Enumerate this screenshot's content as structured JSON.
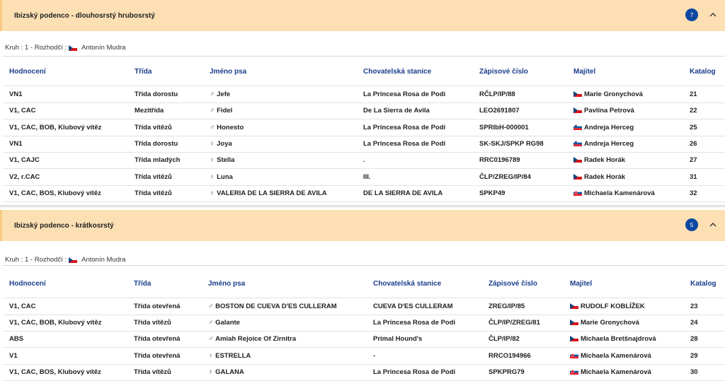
{
  "sections": [
    {
      "title": "Ibizský podenco - dlouhosrstý hrubosrstý",
      "count": "7",
      "kruh": "Kruh : 1 - Rozhodčí :",
      "judge": "Antonín Mudra",
      "headers": [
        "Hodnocení",
        "Třída",
        "Jméno psa",
        "Chovatelská stanice",
        "Zápisové číslo",
        "Majitel",
        "Katalog"
      ],
      "rows": [
        {
          "hodnoceni": "VN1",
          "trida": "Třída dorostu",
          "sex": "♂",
          "jmeno": "Jefe",
          "stanice": "La Princesa Rosa de Podi",
          "zapis": "RČLP/IP/88",
          "flag": "cz",
          "majitel": "Marie Gronychová",
          "katalog": "21"
        },
        {
          "hodnoceni": "V1, CAC",
          "trida": "Mezitřída",
          "sex": "♂",
          "jmeno": "Fidel",
          "stanice": "De La Sierra de Avila",
          "zapis": "LEO2691807",
          "flag": "cz",
          "majitel": "Pavlína Petrová",
          "katalog": "22"
        },
        {
          "hodnoceni": "V1, CAC, BOB, Klubový vítěz",
          "trida": "Třída vítězů",
          "sex": "♂",
          "jmeno": "Honesto",
          "stanice": "La Princesa Rosa de Podi",
          "zapis": "SPRIbH-000001",
          "flag": "si",
          "majitel": "Andreja Herceg",
          "katalog": "25"
        },
        {
          "hodnoceni": "VN1",
          "trida": "Třída dorostu",
          "sex": "♀",
          "jmeno": "Joya",
          "stanice": "La Princesa Rosa de Podi",
          "zapis": "SK-SKJ/SPKP RG98",
          "flag": "si",
          "majitel": "Andreja Herceg",
          "katalog": "26"
        },
        {
          "hodnoceni": "V1, CAJC",
          "trida": "Třída mladých",
          "sex": "♀",
          "jmeno": "Stella",
          "stanice": ".",
          "zapis": "RRC0196789",
          "flag": "cz",
          "majitel": "Radek Horák",
          "katalog": "27"
        },
        {
          "hodnoceni": "V2, r.CAC",
          "trida": "Třída vítězů",
          "sex": "♀",
          "jmeno": "Luna",
          "stanice": "III.",
          "zapis": "ČLP/ZREG/IP/84",
          "flag": "cz",
          "majitel": "Radek Horák",
          "katalog": "31"
        },
        {
          "hodnoceni": "V1, CAC, BOS, Klubový vítěz",
          "trida": "Třída vítězů",
          "sex": "♀",
          "jmeno": "VALERIA DE LA SIERRA DE AVILA",
          "stanice": "DE LA SIERRA DE AVILA",
          "zapis": "SPKP49",
          "flag": "sk",
          "majitel": "Michaela Kamenárová",
          "katalog": "32"
        }
      ]
    },
    {
      "title": "Ibizský podenco - krátkosrstý",
      "count": "5",
      "kruh": "Kruh : 1 - Rozhodčí :",
      "judge": "Antonín Mudra",
      "headers": [
        "Hodnocení",
        "Třída",
        "Jméno psa",
        "Chovatelská stanice",
        "Zápisové číslo",
        "Majitel",
        "Katalog"
      ],
      "rows": [
        {
          "hodnoceni": "V1, CAC",
          "trida": "Třída otevřená",
          "sex": "♂",
          "jmeno": "BOSTON DE CUEVA D'ES CULLERAM",
          "stanice": "CUEVA D'ES CULLERAM",
          "zapis": "ZREG/IP/85",
          "flag": "cz",
          "majitel": "RUDOLF KOBLÍŽEK",
          "katalog": "23"
        },
        {
          "hodnoceni": "V1, CAC, BOB, Klubový vítěz",
          "trida": "Třída vítězů",
          "sex": "♂",
          "jmeno": "Galante",
          "stanice": "La Princesa Rosa de Podi",
          "zapis": "ČLP/IP/ZREG/81",
          "flag": "cz",
          "majitel": "Marie Gronychová",
          "katalog": "24"
        },
        {
          "hodnoceni": "ABS",
          "trida": "Třída otevřená",
          "sex": "♂",
          "jmeno": "Amiah Rejoice Of Zirnitra",
          "stanice": "Primal Hound's",
          "zapis": "ČLP/IP/82",
          "flag": "cz",
          "majitel": "Michaela Bretšnajdrová",
          "katalog": "28"
        },
        {
          "hodnoceni": "V1",
          "trida": "Třída otevřená",
          "sex": "♀",
          "jmeno": "ESTRELLA",
          "stanice": "-",
          "zapis": "RRCO194966",
          "flag": "sk",
          "majitel": "Michaela Kamenárová",
          "katalog": "29"
        },
        {
          "hodnoceni": "V1, CAC, BOS, Klubový vítěz",
          "trida": "Třída vítězů",
          "sex": "♀",
          "jmeno": "GALANA",
          "stanice": "La Princesa Rosa de Podi",
          "zapis": "SPKPRG79",
          "flag": "sk",
          "majitel": "Michaela Kamenárová",
          "katalog": "30"
        }
      ]
    }
  ],
  "colors": {
    "header_bg": "#fce0b4",
    "badge": "#0d47a1",
    "th": "#1a3e8c"
  },
  "icons": {
    "collapse": "chevron-up-icon",
    "male": "♂",
    "female": "♀"
  }
}
